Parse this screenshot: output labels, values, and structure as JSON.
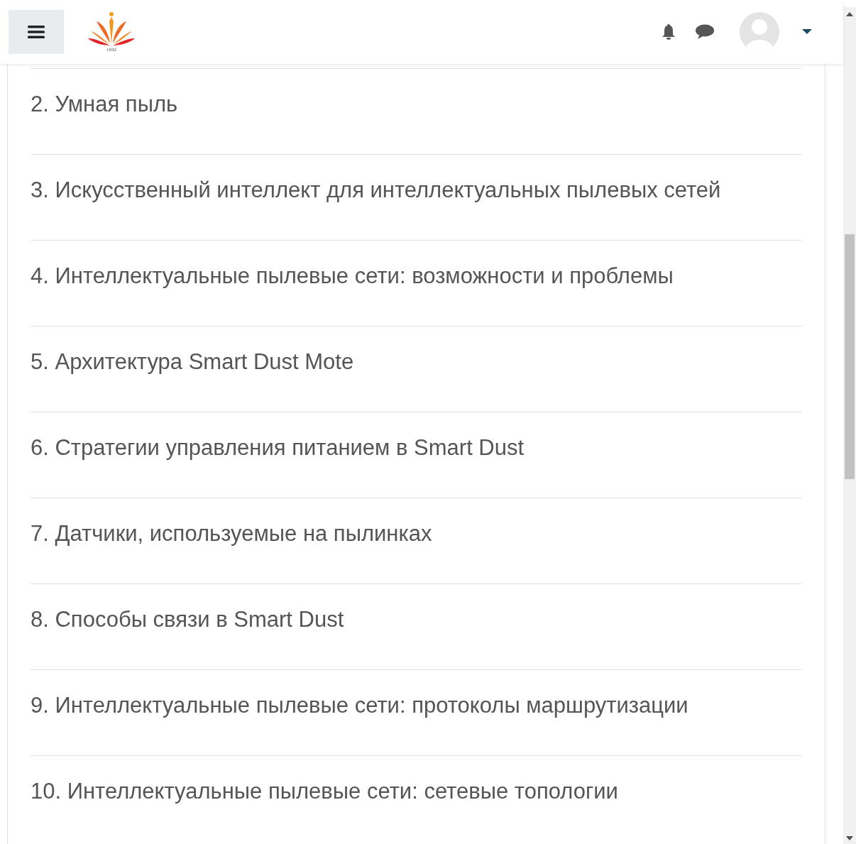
{
  "header": {
    "logo_caption": "1932"
  },
  "sections": [
    {
      "title": "2. Умная пыль"
    },
    {
      "title": "3. Искусственный интеллект для интеллектуальных пылевых сетей"
    },
    {
      "title": "4. Интеллектуальные пылевые сети: возможности и проблемы"
    },
    {
      "title": "5. Архитектура Smart Dust Mote"
    },
    {
      "title": "6. Стратегии управления питанием в Smart Dust"
    },
    {
      "title": "7. Датчики, используемые на пылинках"
    },
    {
      "title": "8. Способы связи в Smart Dust"
    },
    {
      "title": "9. Интеллектуальные пылевые сети: протоколы маршрутизации"
    },
    {
      "title": "10. Интеллектуальные пылевые сети: сетевые топологии"
    }
  ]
}
